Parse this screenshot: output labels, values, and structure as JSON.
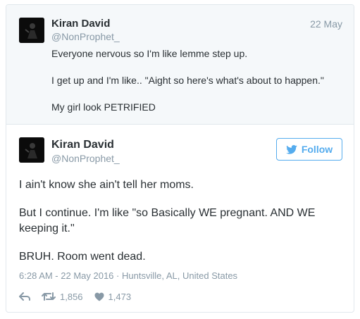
{
  "parent_tweet": {
    "name": "Kiran David",
    "handle": "@NonProphet_",
    "date": "22 May",
    "paragraphs": [
      "Everyone nervous so I'm like lemme step up.",
      "I get up and I'm like.. \"Aight so here's what's about to happen.\"",
      "My girl look PETRIFIED"
    ]
  },
  "main_tweet": {
    "name": "Kiran David",
    "handle": "@NonProphet_",
    "follow_label": "Follow",
    "paragraphs": [
      "I ain't know she ain't tell her moms.",
      "But I continue. I'm like \"so Basically WE pregnant. AND WE keeping it.\"",
      "BRUH. Room went dead."
    ],
    "timestamp": "6:28 AM - 22 May 2016",
    "separator": "·",
    "location": "Huntsville, AL, United States",
    "retweet_count": "1,856",
    "like_count": "1,473"
  },
  "icons": {
    "follow": "twitter-bird-icon",
    "reply": "reply-arrow-icon",
    "retweet": "retweet-icon",
    "like": "heart-icon"
  },
  "colors": {
    "accent": "#55acee",
    "muted": "#8899a6",
    "text": "#292f33",
    "parent_bg": "#f5f8fa",
    "border": "#e1e8ed"
  }
}
